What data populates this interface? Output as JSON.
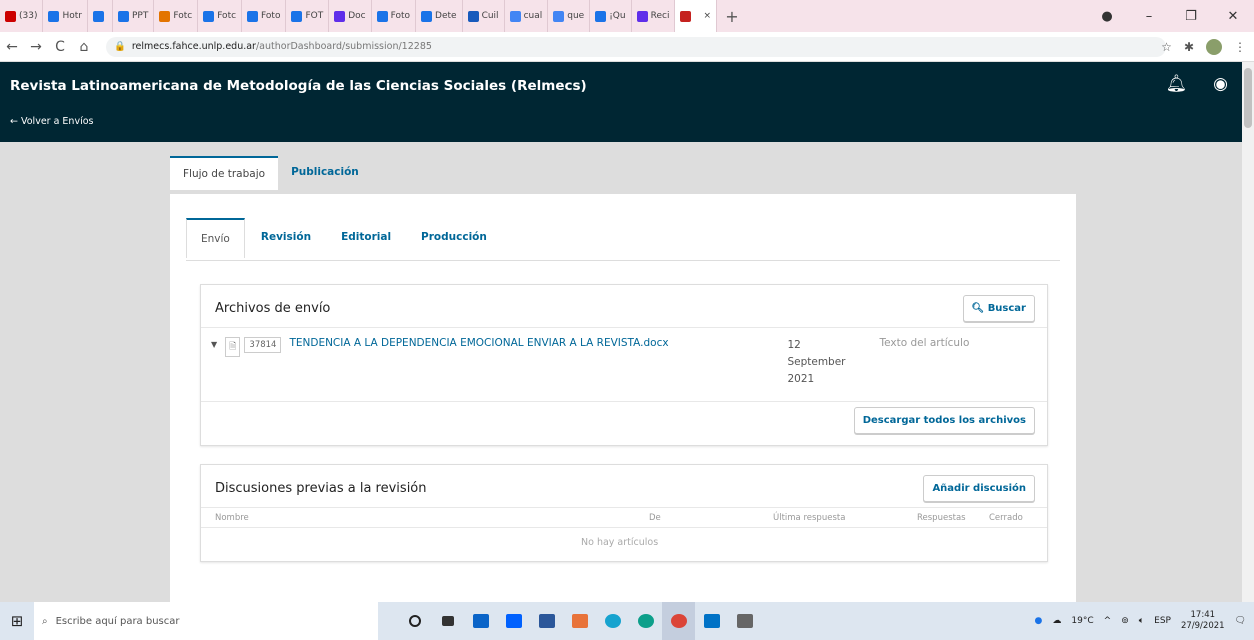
{
  "browser": {
    "tabs": [
      {
        "label": "(33)",
        "color": "#cc0000"
      },
      {
        "label": "Hotr",
        "color": "#1a73e8"
      },
      {
        "label": "",
        "color": "#1a73e8"
      },
      {
        "label": "PPT",
        "color": "#1a73e8"
      },
      {
        "label": "Fotc",
        "color": "#e37400"
      },
      {
        "label": "Fotc",
        "color": "#1a73e8"
      },
      {
        "label": "Foto",
        "color": "#1a73e8"
      },
      {
        "label": "FOT",
        "color": "#1a73e8"
      },
      {
        "label": "Doc",
        "color": "#5f2eea"
      },
      {
        "label": "Foto",
        "color": "#1a73e8"
      },
      {
        "label": "Dete",
        "color": "#1a73e8"
      },
      {
        "label": "Cuil",
        "color": "#185abc"
      },
      {
        "label": "cual",
        "color": "#4285f4"
      },
      {
        "label": "que",
        "color": "#4285f4"
      },
      {
        "label": "¡Qu",
        "color": "#1a73e8"
      },
      {
        "label": "Reci",
        "color": "#5f2eea"
      },
      {
        "label": "",
        "color": "#c5221f"
      }
    ],
    "new_tab": "+",
    "url_host": "relmecs.fahce.unlp.edu.ar",
    "url_path": "/authorDashboard/submission/12285"
  },
  "header": {
    "title": "Revista Latinoamericana de Metodología de las Ciencias Sociales (Relmecs)",
    "back": "← Volver a Envíos"
  },
  "page_tabs": [
    "Flujo de trabajo",
    "Publicación"
  ],
  "stage_tabs": [
    "Envío",
    "Revisión",
    "Editorial",
    "Producción"
  ],
  "files": {
    "heading": "Archivos de envío",
    "search_label": "Buscar",
    "row": {
      "id": "37814",
      "name": "TENDENCIA A LA DEPENDENCIA EMOCIONAL ENVIAR A LA REVISTA.docx",
      "date_day": "12",
      "date_month": "September",
      "date_year": "2021",
      "type": "Texto del artículo"
    },
    "download_all": "Descargar todos los archivos"
  },
  "discussions": {
    "heading": "Discusiones previas a la revisión",
    "add_label": "Añadir discusión",
    "columns": [
      "Nombre",
      "De",
      "Última respuesta",
      "Respuestas",
      "Cerrado"
    ],
    "empty": "No hay artículos"
  },
  "taskbar": {
    "search_placeholder": "Escribe aquí para buscar",
    "temp": "19°C",
    "lang": "ESP",
    "time": "17:41",
    "date": "27/9/2021"
  }
}
